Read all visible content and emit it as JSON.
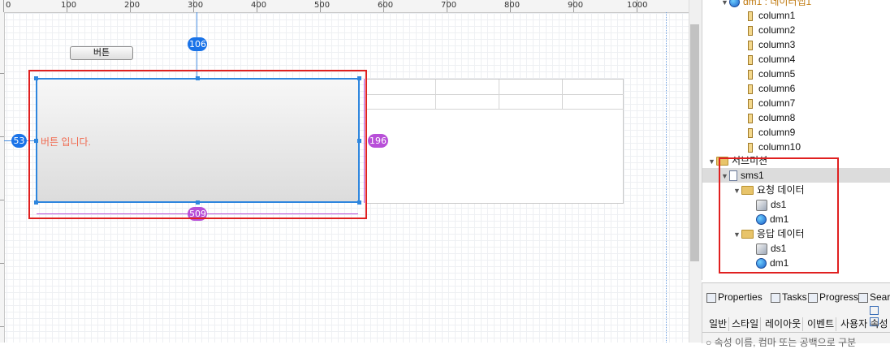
{
  "ruler": {
    "labels": [
      "100",
      "200",
      "300",
      "400",
      "500",
      "600",
      "700",
      "800",
      "900",
      "1000"
    ]
  },
  "canvas": {
    "button_label": "버튼",
    "selected_button_text": "버튼 입니다.",
    "dimensions": {
      "top": "106",
      "left": "53",
      "height": "196",
      "width": "509"
    }
  },
  "outline": {
    "dm1_node": "dm1 : 데이터맵1",
    "columns": [
      "column1",
      "column2",
      "column3",
      "column4",
      "column5",
      "column6",
      "column7",
      "column8",
      "column9",
      "column10"
    ],
    "submission_group": "서브미션",
    "sms1": "sms1",
    "request_folder": "요청 데이터",
    "request_items": [
      "ds1",
      "dm1"
    ],
    "response_folder": "응답 데이터",
    "response_items": [
      "ds1",
      "dm1"
    ]
  },
  "panel": {
    "tabs": [
      "Properties",
      "Tasks",
      "Progress",
      "Search"
    ],
    "prop_tabs": [
      "일반",
      "스타일",
      "레이아웃",
      "이벤트",
      "사용자 속성"
    ],
    "search_placeholder": "속성 이름, 컴마 또는 공백으로 구분"
  },
  "colors": {
    "highlight": "#e02020",
    "selection": "#2e86de",
    "badge_blue": "#1a73e8",
    "badge_purple": "#b84fd8"
  }
}
